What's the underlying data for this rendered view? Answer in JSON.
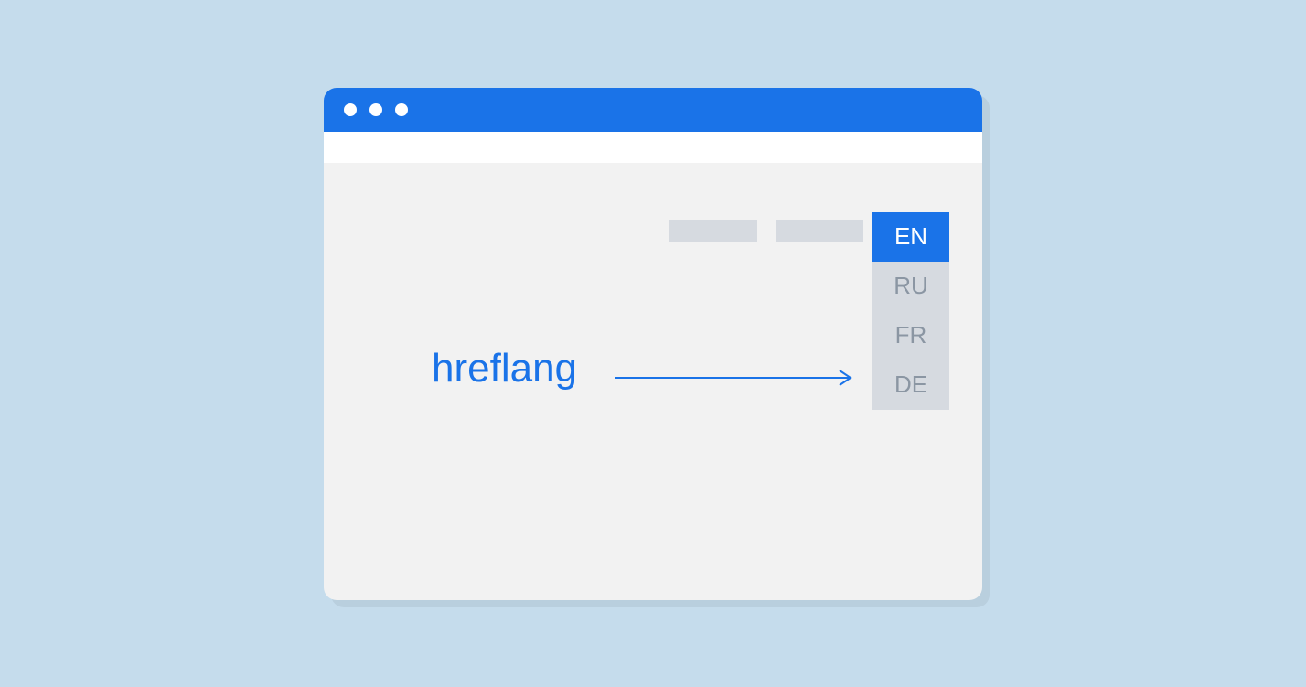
{
  "label": "hreflang",
  "languages": {
    "selected": "EN",
    "options": [
      "RU",
      "FR",
      "DE"
    ]
  },
  "colors": {
    "accent": "#1a73e8",
    "background": "#c5dcec",
    "window": "#f2f2f2",
    "placeholder": "#d6dae0",
    "muted_text": "#8b96a3"
  }
}
